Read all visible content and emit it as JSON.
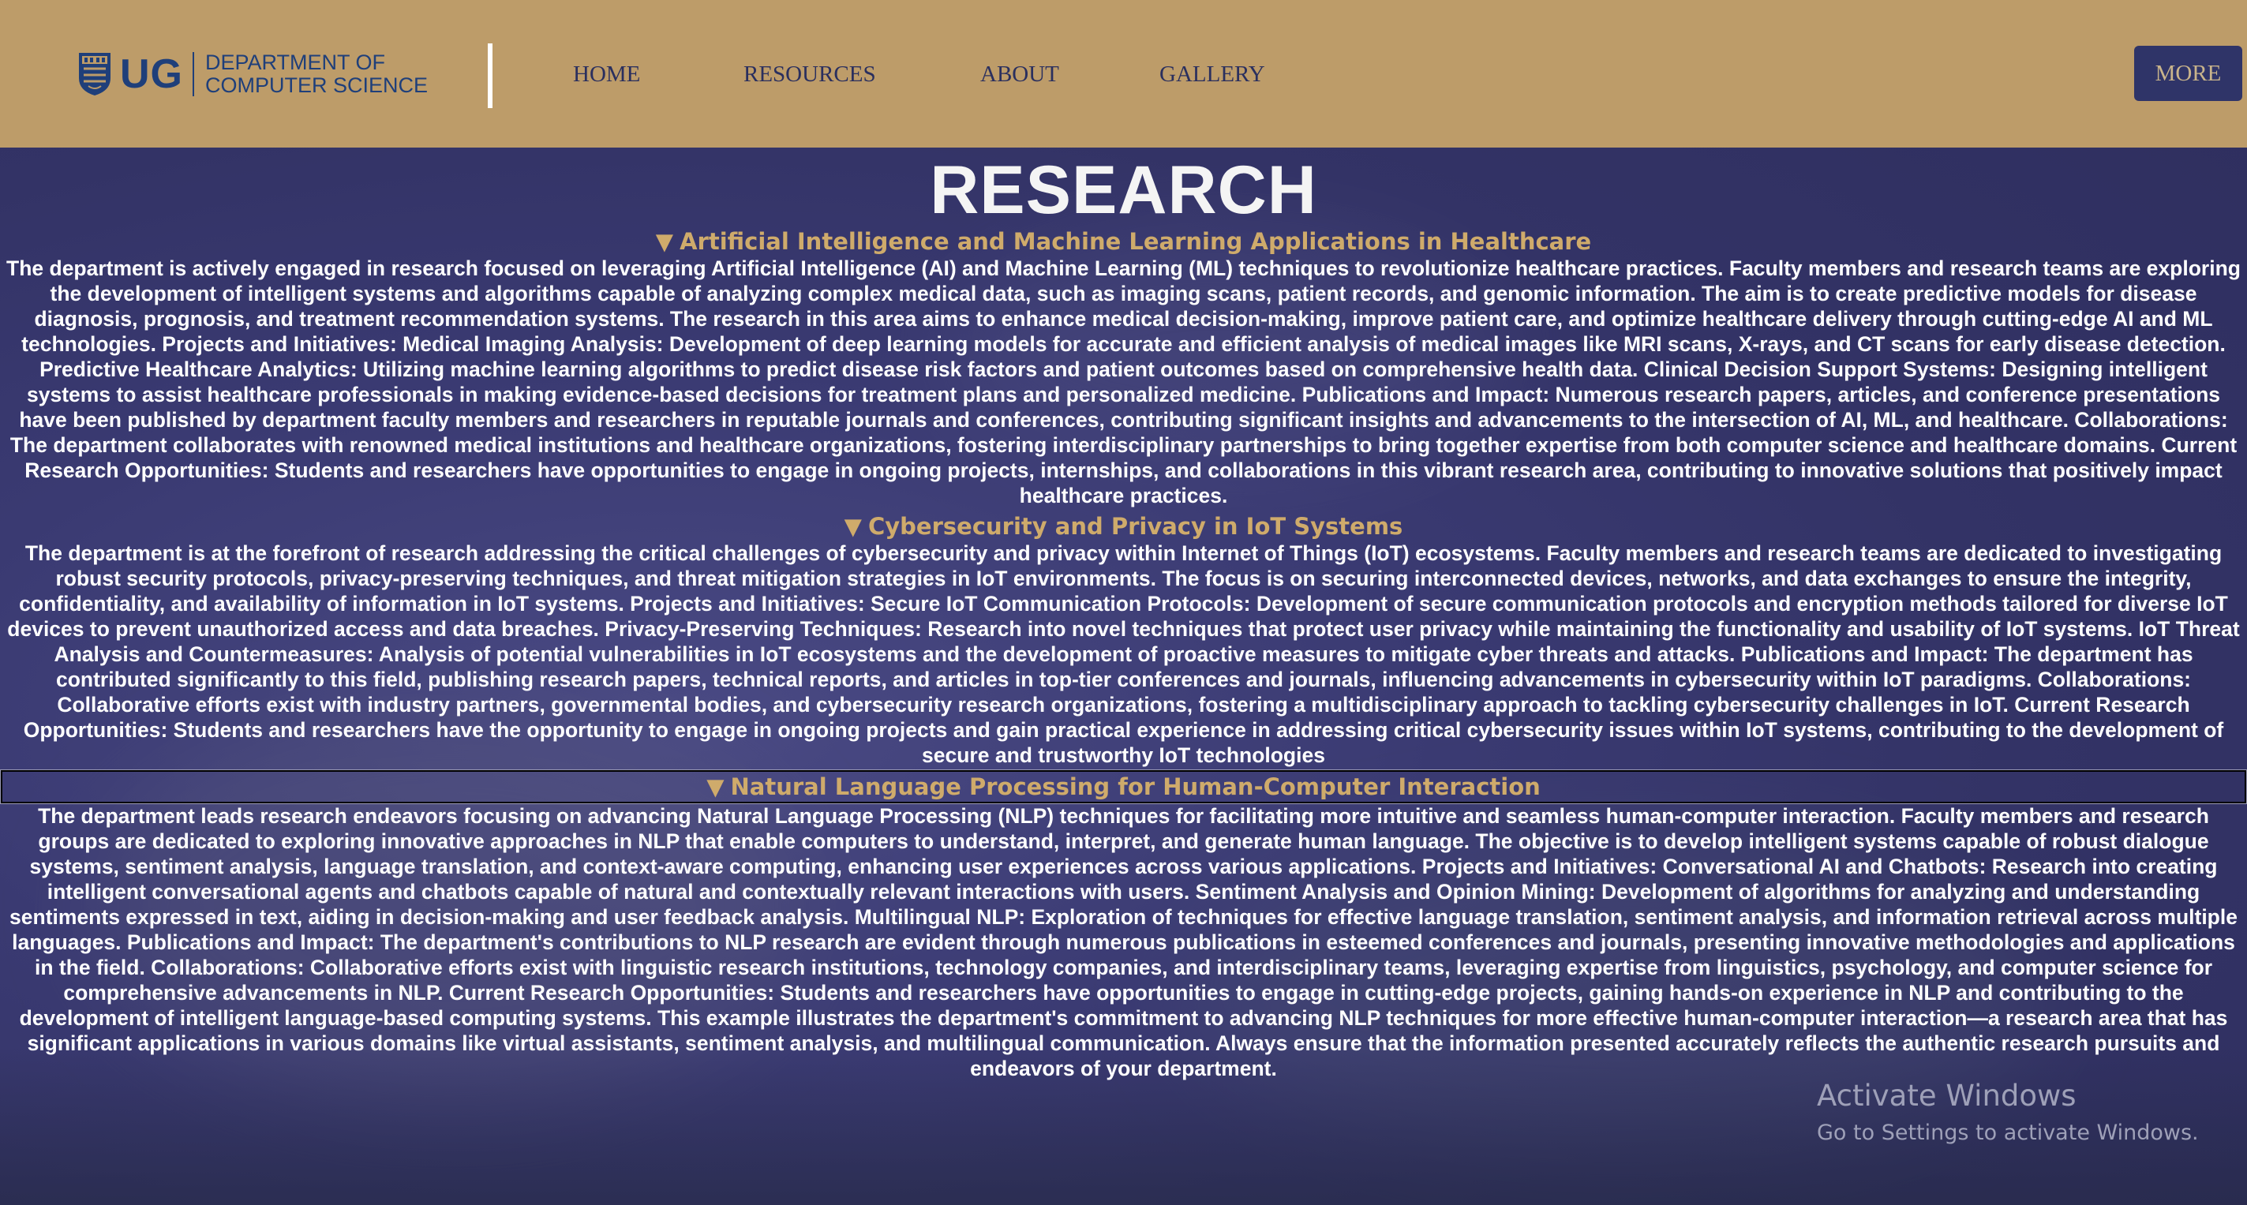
{
  "header": {
    "logo_abbr": "UG",
    "logo_line1": "DEPARTMENT OF",
    "logo_line2": "COMPUTER SCIENCE",
    "nav": [
      {
        "label": "HOME"
      },
      {
        "label": "RESOURCES"
      },
      {
        "label": "ABOUT"
      },
      {
        "label": "GALLERY"
      }
    ],
    "more_label": "MORE"
  },
  "page": {
    "title": "RESEARCH"
  },
  "sections": [
    {
      "marker": "▼",
      "heading": "Artificial Intelligence and Machine Learning Applications in Healthcare",
      "body": "The department is actively engaged in research focused on leveraging Artificial Intelligence (AI) and Machine Learning (ML) techniques to revolutionize healthcare practices. Faculty members and research teams are exploring the development of intelligent systems and algorithms capable of analyzing complex medical data, such as imaging scans, patient records, and genomic information. The aim is to create predictive models for disease diagnosis, prognosis, and treatment recommendation systems. The research in this area aims to enhance medical decision-making, improve patient care, and optimize healthcare delivery through cutting-edge AI and ML technologies. Projects and Initiatives: Medical Imaging Analysis: Development of deep learning models for accurate and efficient analysis of medical images like MRI scans, X-rays, and CT scans for early disease detection. Predictive Healthcare Analytics: Utilizing machine learning algorithms to predict disease risk factors and patient outcomes based on comprehensive health data. Clinical Decision Support Systems: Designing intelligent systems to assist healthcare professionals in making evidence-based decisions for treatment plans and personalized medicine. Publications and Impact: Numerous research papers, articles, and conference presentations have been published by department faculty members and researchers in reputable journals and conferences, contributing significant insights and advancements to the intersection of AI, ML, and healthcare. Collaborations: The department collaborates with renowned medical institutions and healthcare organizations, fostering interdisciplinary partnerships to bring together expertise from both computer science and healthcare domains. Current Research Opportunities: Students and researchers have opportunities to engage in ongoing projects, internships, and collaborations in this vibrant research area, contributing to innovative solutions that positively impact healthcare practices."
    },
    {
      "marker": "▼",
      "heading": "Cybersecurity and Privacy in IoT Systems",
      "body": "The department is at the forefront of research addressing the critical challenges of cybersecurity and privacy within Internet of Things (IoT) ecosystems. Faculty members and research teams are dedicated to investigating robust security protocols, privacy-preserving techniques, and threat mitigation strategies in IoT environments. The focus is on securing interconnected devices, networks, and data exchanges to ensure the integrity, confidentiality, and availability of information in IoT systems. Projects and Initiatives: Secure IoT Communication Protocols: Development of secure communication protocols and encryption methods tailored for diverse IoT devices to prevent unauthorized access and data breaches. Privacy-Preserving Techniques: Research into novel techniques that protect user privacy while maintaining the functionality and usability of IoT systems. IoT Threat Analysis and Countermeasures: Analysis of potential vulnerabilities in IoT ecosystems and the development of proactive measures to mitigate cyber threats and attacks. Publications and Impact: The department has contributed significantly to this field, publishing research papers, technical reports, and articles in top-tier conferences and journals, influencing advancements in cybersecurity within IoT paradigms. Collaborations: Collaborative efforts exist with industry partners, governmental bodies, and cybersecurity research organizations, fostering a multidisciplinary approach to tackling cybersecurity challenges in IoT. Current Research Opportunities: Students and researchers have the opportunity to engage in ongoing projects and gain practical experience in addressing critical cybersecurity issues within IoT systems, contributing to the development of secure and trustworthy IoT technologies"
    },
    {
      "marker": "▼",
      "heading": "Natural Language Processing for Human-Computer Interaction",
      "body": "The department leads research endeavors focusing on advancing Natural Language Processing (NLP) techniques for facilitating more intuitive and seamless human-computer interaction. Faculty members and research groups are dedicated to exploring innovative approaches in NLP that enable computers to understand, interpret, and generate human language. The objective is to develop intelligent systems capable of robust dialogue systems, sentiment analysis, language translation, and context-aware computing, enhancing user experiences across various applications. Projects and Initiatives: Conversational AI and Chatbots: Research into creating intelligent conversational agents and chatbots capable of natural and contextually relevant interactions with users. Sentiment Analysis and Opinion Mining: Development of algorithms for analyzing and understanding sentiments expressed in text, aiding in decision-making and user feedback analysis. Multilingual NLP: Exploration of techniques for effective language translation, sentiment analysis, and information retrieval across multiple languages. Publications and Impact: The department's contributions to NLP research are evident through numerous publications in esteemed conferences and journals, presenting innovative methodologies and applications in the field. Collaborations: Collaborative efforts exist with linguistic research institutions, technology companies, and interdisciplinary teams, leveraging expertise from linguistics, psychology, and computer science for comprehensive advancements in NLP. Current Research Opportunities: Students and researchers have opportunities to engage in cutting-edge projects, gaining hands-on experience in NLP and contributing to the development of intelligent language-based computing systems. This example illustrates the department's commitment to advancing NLP techniques for more effective human-computer interaction—a research area that has significant applications in various domains like virtual assistants, sentiment analysis, and multilingual communication. Always ensure that the information presented accurately reflects the authentic research pursuits and endeavors of your department."
    }
  ],
  "watermark": {
    "line1": "Activate Windows",
    "line2": "Go to Settings to activate Windows."
  },
  "colors": {
    "header_bg": "#bd9c69",
    "nav_text": "#2a2f5e",
    "logo_blue": "#1f3f7a",
    "heading_gold": "#cfab6b",
    "more_button_bg": "#2f3468",
    "page_bg": "#3a3a72"
  },
  "icons": {
    "logo": "university-crest-icon",
    "section_marker": "triangle-down-icon"
  }
}
